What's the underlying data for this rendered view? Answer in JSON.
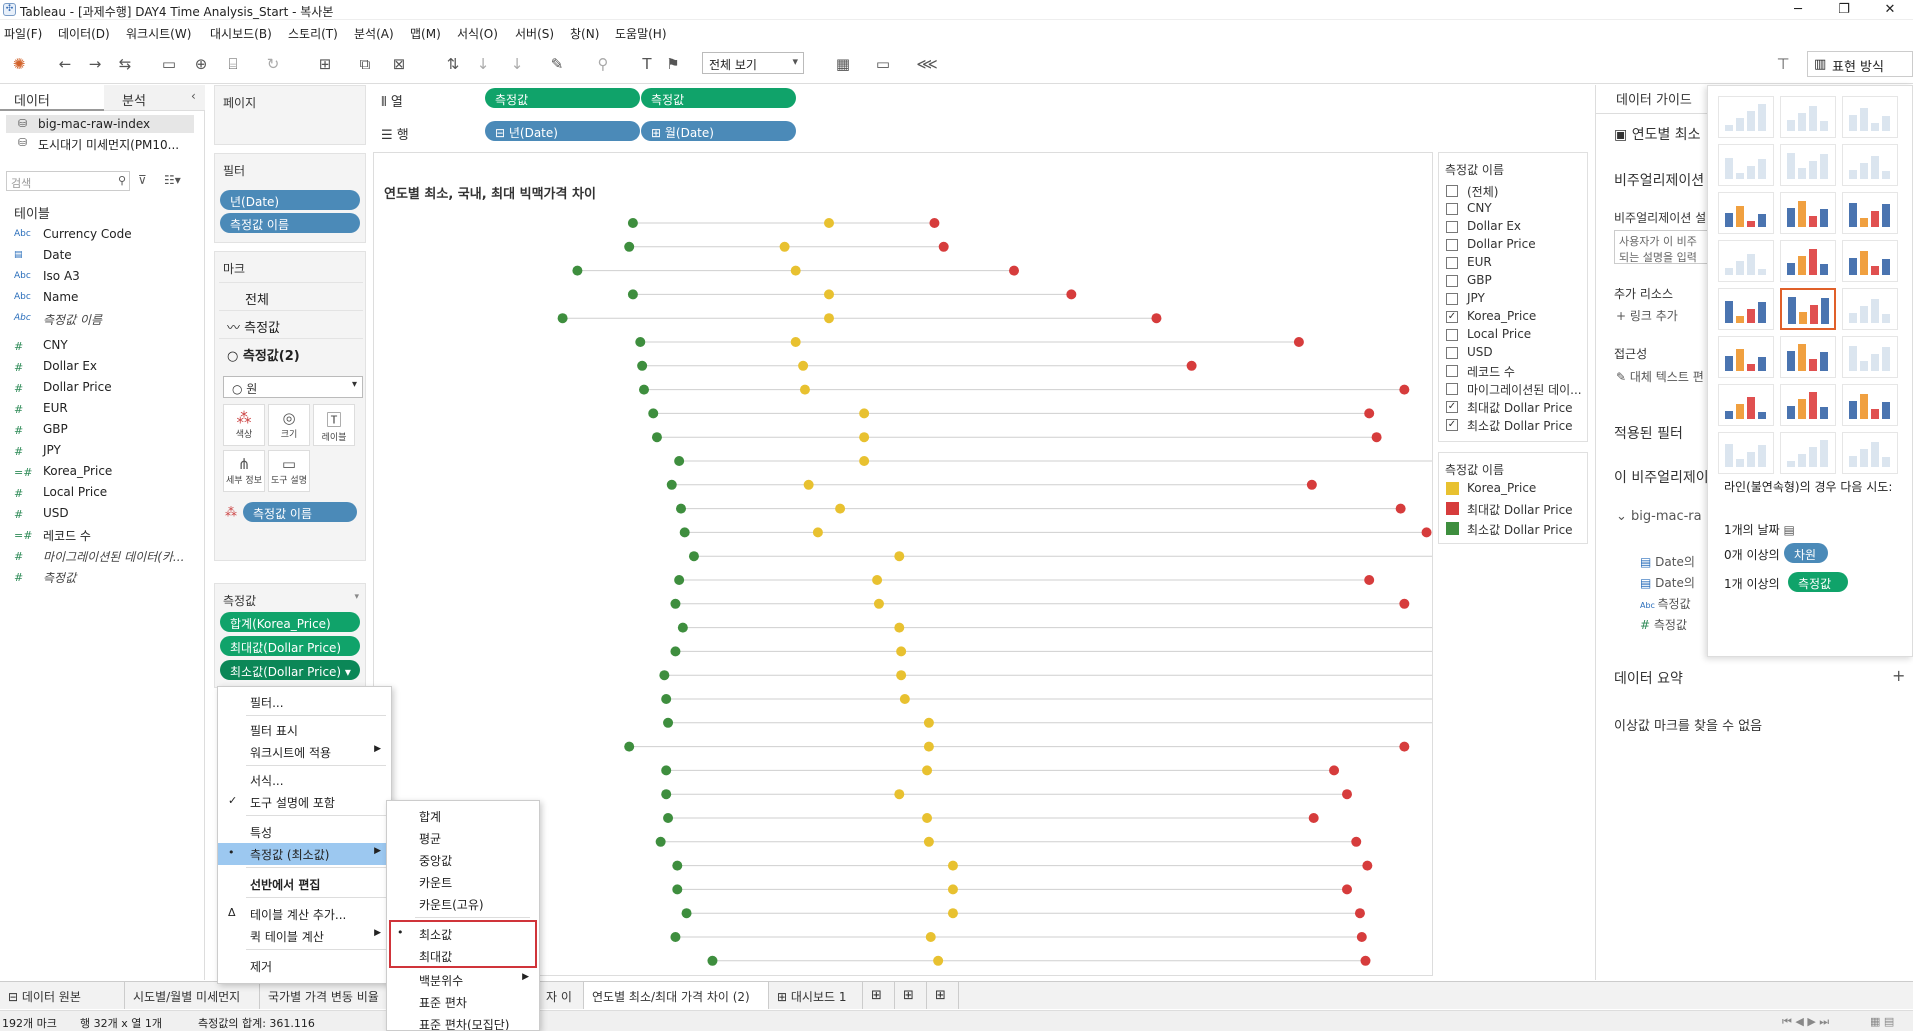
{
  "window": {
    "title": "Tableau - [과제수행] DAY4 Time Analysis_Start - 복사본",
    "min": "─",
    "restore": "❐",
    "close": "✕"
  },
  "menu": [
    "파일(F)",
    "데이터(D)",
    "워크시트(W)",
    "대시보드(B)",
    "스토리(T)",
    "분석(A)",
    "맵(M)",
    "서식(O)",
    "서버(S)",
    "창(N)",
    "도움말(H)"
  ],
  "toolbar": {
    "view_select": "전체 보기",
    "show_me": "표현 방식"
  },
  "left": {
    "tab_data": "데이터",
    "tab_analysis": "분석",
    "sources": [
      "big-mac-raw-index",
      "도시대기 미세먼지(PM10..."
    ],
    "search_placeholder": "검색",
    "tables_label": "테이블",
    "fields": [
      {
        "type": "Abc",
        "name": "Currency Code",
        "italic": false
      },
      {
        "type": "cal",
        "name": "Date",
        "italic": false
      },
      {
        "type": "Abc",
        "name": "Iso A3",
        "italic": false
      },
      {
        "type": "Abc",
        "name": "Name",
        "italic": false
      },
      {
        "type": "Abc",
        "name": "측정값 이름",
        "italic": true
      },
      {
        "type": "#",
        "name": "CNY",
        "italic": false
      },
      {
        "type": "#",
        "name": "Dollar Ex",
        "italic": false
      },
      {
        "type": "#",
        "name": "Dollar Price",
        "italic": false
      },
      {
        "type": "#",
        "name": "EUR",
        "italic": false
      },
      {
        "type": "#",
        "name": "GBP",
        "italic": false
      },
      {
        "type": "#",
        "name": "JPY",
        "italic": false
      },
      {
        "type": "=#",
        "name": "Korea_Price",
        "italic": false
      },
      {
        "type": "#",
        "name": "Local Price",
        "italic": false
      },
      {
        "type": "#",
        "name": "USD",
        "italic": false
      },
      {
        "type": "=#",
        "name": "레코드 수",
        "italic": false
      },
      {
        "type": "#",
        "name": "마이그레이션된 데이터(카...",
        "italic": true
      },
      {
        "type": "#",
        "name": "측정값",
        "italic": true
      }
    ]
  },
  "pages": {
    "label": "페이지"
  },
  "filters": {
    "label": "필터",
    "pills": [
      "년(Date)",
      "측정값 이름"
    ]
  },
  "marks": {
    "label": "마크",
    "all": "전체",
    "m1": "측정값",
    "m2": "측정값(2)",
    "type": "원",
    "buttons": [
      "색상",
      "크기",
      "레이블",
      "세부 정보",
      "도구 설명"
    ],
    "color_pill": "측정값 이름"
  },
  "measures": {
    "label": "측정값",
    "pills": [
      "합계(Korea_Price)",
      "최대값(Dollar Price)",
      "최소값(Dollar Price) ▾"
    ]
  },
  "shelves": {
    "columns_label": "열",
    "rows_label": "행",
    "col_pills": [
      "측정값",
      "측정값"
    ],
    "row_pills": [
      "⊟ 년(Date)",
      "⊞ 월(Date)"
    ]
  },
  "viz": {
    "title": "연도별 최소, 국내, 최대 빅맥가격 차이"
  },
  "legend1": {
    "title": "측정값 이름",
    "items": [
      {
        "label": "(전체)",
        "checked": false
      },
      {
        "label": "CNY",
        "checked": false
      },
      {
        "label": "Dollar Ex",
        "checked": false
      },
      {
        "label": "Dollar Price",
        "checked": false
      },
      {
        "label": "EUR",
        "checked": false
      },
      {
        "label": "GBP",
        "checked": false
      },
      {
        "label": "JPY",
        "checked": false
      },
      {
        "label": "Korea_Price",
        "checked": true
      },
      {
        "label": "Local Price",
        "checked": false
      },
      {
        "label": "USD",
        "checked": false
      },
      {
        "label": "레코드 수",
        "checked": false
      },
      {
        "label": "마이그레이션된 데이...",
        "checked": false
      },
      {
        "label": "최대값 Dollar Price",
        "checked": true
      },
      {
        "label": "최소값 Dollar Price",
        "checked": true
      }
    ]
  },
  "legend2": {
    "title": "측정값 이름",
    "items": [
      {
        "label": "Korea_Price",
        "color": "#e8c130"
      },
      {
        "label": "최대값 Dollar Price",
        "color": "#d63c3c"
      },
      {
        "label": "최소값 Dollar Price",
        "color": "#3e8e3e"
      }
    ]
  },
  "guide": {
    "title": "데이터 가이드",
    "sheet": "연도별 최소",
    "viz_desc": "비주얼리제이션",
    "desc_label": "비주얼리제이션 설",
    "desc_box": "사용자가 이 비주 되는 설명을 입력",
    "resources": "추가 리소스",
    "link_add": "링크 추가",
    "access": "접근성",
    "alt_text": "대체 텍스트 편",
    "filters": "적용된 필터",
    "this_viz": "이 비주얼리제이",
    "src": "big-mac-ra",
    "f1": "Date의",
    "f2": "Date의",
    "f3": "측정값",
    "f4": "측정값",
    "summary": "데이터 요약",
    "plus": "+",
    "outlier": "이상값 마크를 찾을 수 없음"
  },
  "showme": {
    "hint": "라인(불연속형)의 경우 다음 시도:",
    "r1": "1개의 날짜",
    "r2a": "0개 이상의",
    "r2b": "차원",
    "r3a": "1개 이상의",
    "r3b": "측정값"
  },
  "context_menu": [
    "필터...",
    "필터 표시",
    "워크시트에 적용",
    "서식...",
    "도구 설명에 포함",
    "특성",
    "측정값 (최소값)",
    "선반에서 편집",
    "테이블 계산 추가...",
    "퀵 테이블 계산",
    "제거"
  ],
  "submenu": [
    "합계",
    "평균",
    "중앙값",
    "카운트",
    "카운트(고유)",
    "최소값",
    "최대값",
    "백분위수",
    "표준 편차",
    "표준 편차(모집단)"
  ],
  "tabs": [
    "⊟ 데이터 원본",
    "시도별/월별 미세먼지",
    "국가별 가격 변동 비율",
    "자 이",
    "연도별 최소/최대 가격 차이 (2)",
    "⊞ 대시보드 1"
  ],
  "status": {
    "marks": "192개 마크",
    "rows": "행 32개 x 열 1개",
    "sum": "측정값의 합계: 361.116"
  },
  "chart_data": {
    "type": "scatter",
    "series": [
      {
        "name": "최소값 Dollar Price",
        "color": "#3e8e3e",
        "values": [
          1.94,
          1.92,
          1.64,
          1.94,
          1.56,
          1.98,
          1.99,
          2.0,
          2.05,
          2.07,
          2.19,
          2.15,
          2.2,
          2.22,
          2.27,
          2.19,
          2.17,
          2.21,
          2.17,
          2.11,
          2.12,
          2.13,
          1.92,
          2.12,
          2.12,
          2.13,
          2.09,
          2.18,
          2.18,
          2.23,
          2.17,
          2.37,
          2.41
        ]
      },
      {
        "name": "Korea_Price",
        "color": "#e8c130",
        "values": [
          3.0,
          2.76,
          2.82,
          3.0,
          3.0,
          2.82,
          2.86,
          2.87,
          3.19,
          3.19,
          3.19,
          2.89,
          3.06,
          2.94,
          3.38,
          3.26,
          3.27,
          3.38,
          3.39,
          3.39,
          3.41,
          3.54,
          3.54,
          3.53,
          3.38,
          3.53,
          3.54,
          3.67,
          3.67,
          3.67,
          3.55,
          3.59
        ]
      },
      {
        "name": "최대값 Dollar Price",
        "color": "#d63c3c",
        "values": [
          3.57,
          3.62,
          4.0,
          4.31,
          4.77,
          5.54,
          4.96,
          6.11,
          5.92,
          5.96,
          6.8,
          5.61,
          6.09,
          6.23,
          7.09,
          5.92,
          6.11,
          6.76,
          6.82,
          6.8,
          6.76,
          6.49,
          6.11,
          5.73,
          5.8,
          5.62,
          5.85,
          5.91,
          5.8,
          5.87,
          5.88,
          5.9
        ]
      }
    ],
    "x": "Dollar Price"
  }
}
